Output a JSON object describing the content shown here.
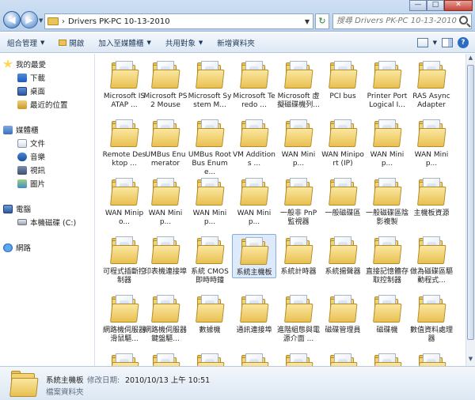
{
  "window": {
    "address_path": "Drivers PK-PC 10-13-2010",
    "search_placeholder": "搜尋 Drivers PK-PC 10-13-2010",
    "buttons": {
      "minimize": "—",
      "maximize": "□",
      "close": "✕"
    }
  },
  "toolbar": {
    "organize": "組合管理",
    "open": "開啟",
    "add_to_library": "加入至媒體櫃",
    "share_with": "共用對象",
    "new_folder": "新增資料夾"
  },
  "sidebar": {
    "favorites": {
      "label": "我的最愛",
      "items": [
        "下載",
        "桌面",
        "最近的位置"
      ]
    },
    "libraries": {
      "label": "媒體櫃",
      "items": [
        "文件",
        "音樂",
        "視訊",
        "圖片"
      ]
    },
    "computer": {
      "label": "電腦",
      "items": [
        "本機磁碟 (C:)"
      ]
    },
    "network": {
      "label": "網路"
    }
  },
  "folders": [
    "Microsoft ISATAP ...",
    "Microsoft PS 2 Mouse",
    "Microsoft System M...",
    "Microsoft Teredo ...",
    "Microsoft 虛擬磁碟機列...",
    "PCI bus",
    "Printer Port Logical I...",
    "RAS Async Adapter",
    "Remote Desktop ...",
    "UMBus Enumerator",
    "UMBus Root Bus Enume...",
    "VM Additions ...",
    "WAN Minip...",
    "WAN Miniport (IP)",
    "WAN Minip...",
    "WAN Minip...",
    "WAN Minipo...",
    "WAN Minip...",
    "WAN Minip...",
    "WAN Minip...",
    "一般非 PnP 監視器",
    "一般磁碟區",
    "一般磁碟區陰影複製",
    "主機板資源",
    "可程式插斷控制器",
    "印表機連接埠",
    "系統 CMOS 即時時鐘",
    "系統主機板",
    "系統計時器",
    "系統揚聲器",
    "直接記憶體存取控制器",
    "做為磁碟區驅動程式...",
    "網路機伺服器滑鼠驅...",
    "網路機伺服器鍵盤驅...",
    "數據機",
    "通訊連接埠",
    "進階組態與電源介面 ...",
    "磁碟管理員",
    "磁碟機",
    "數值資料處理器",
    "",
    "",
    "",
    "",
    "",
    "",
    "",
    ""
  ],
  "selected_folder_index": 27,
  "details": {
    "name": "系統主機板",
    "modified_label": "修改日期:",
    "modified_value": "2010/10/13 上午 10:51",
    "type": "檔案資料夾"
  }
}
